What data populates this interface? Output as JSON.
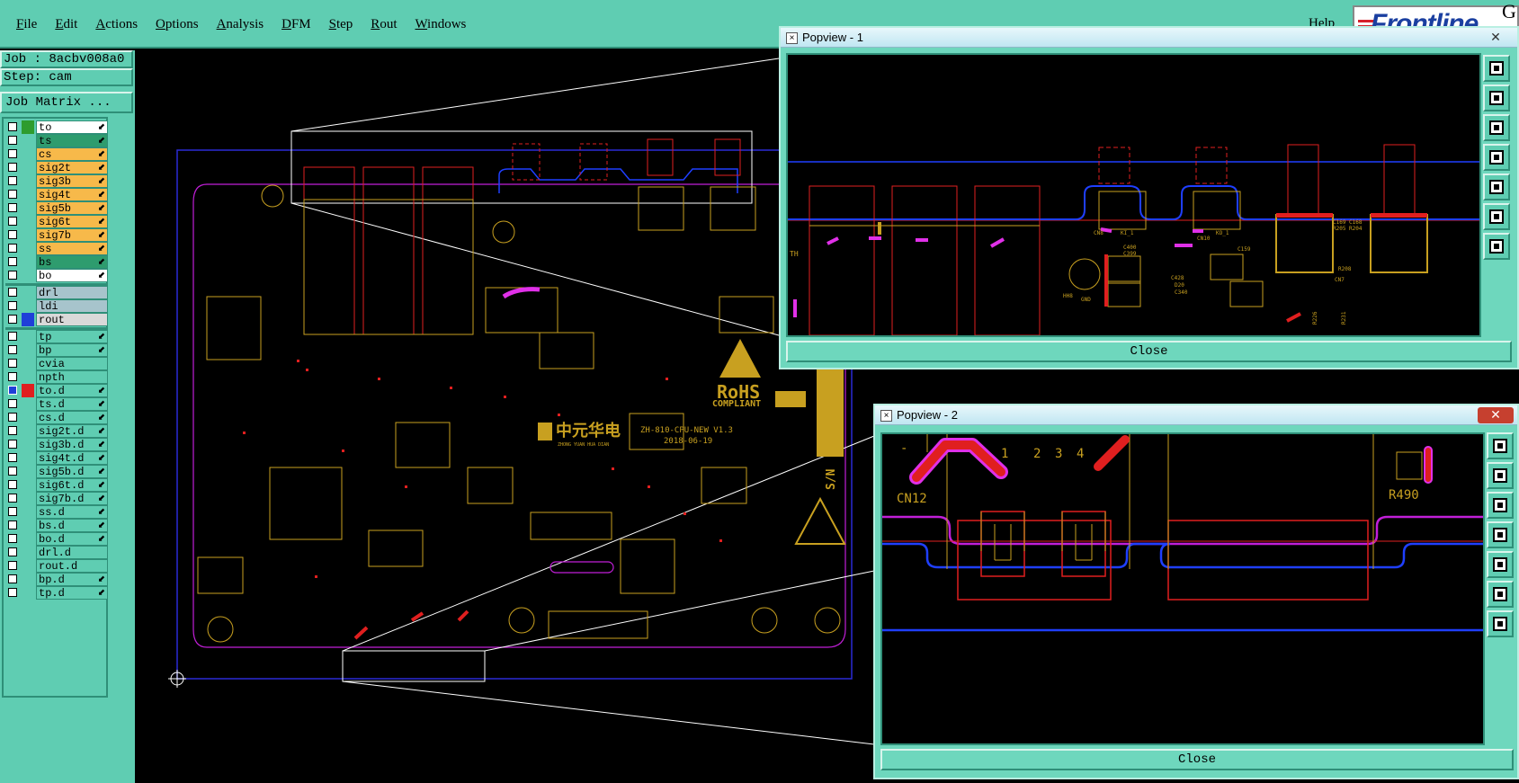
{
  "menu": {
    "items": [
      "File",
      "Edit",
      "Actions",
      "Options",
      "Analysis",
      "DFM",
      "Step",
      "Rout",
      "Windows"
    ],
    "help": "Help",
    "logo": "Frontline",
    "logo_g": "G"
  },
  "info": {
    "job": "Job : 8acbv008a0",
    "step": "Step: cam",
    "job_matrix": "Job Matrix ..."
  },
  "layers": [
    {
      "name": "to",
      "color": "#2e9c2e",
      "bg": "#ffffff",
      "arrow": true
    },
    {
      "name": "ts",
      "color": "",
      "bg": "#2e9c6e",
      "arrow": true
    },
    {
      "name": "cs",
      "color": "",
      "bg": "#f7b94a",
      "arrow": true
    },
    {
      "name": "sig2t",
      "color": "",
      "bg": "#f7b94a",
      "arrow": true
    },
    {
      "name": "sig3b",
      "color": "",
      "bg": "#f7b94a",
      "arrow": true
    },
    {
      "name": "sig4t",
      "color": "",
      "bg": "#f7b94a",
      "arrow": true
    },
    {
      "name": "sig5b",
      "color": "",
      "bg": "#f7b94a",
      "arrow": true
    },
    {
      "name": "sig6t",
      "color": "",
      "bg": "#f7b94a",
      "arrow": true
    },
    {
      "name": "sig7b",
      "color": "",
      "bg": "#f7b94a",
      "arrow": true
    },
    {
      "name": "ss",
      "color": "",
      "bg": "#f7b94a",
      "arrow": true
    },
    {
      "name": "bs",
      "color": "",
      "bg": "#2e9c6e",
      "arrow": true
    },
    {
      "name": "bo",
      "color": "",
      "bg": "#ffffff",
      "arrow": true
    },
    {
      "name": "drl",
      "color": "",
      "bg": "#a7c4cc",
      "arrow": false
    },
    {
      "name": "ldi",
      "color": "",
      "bg": "#a7c4cc",
      "arrow": false
    },
    {
      "name": "rout",
      "color": "#1f3fd8",
      "bg": "#d9d9d9",
      "arrow": false
    },
    {
      "name": "tp",
      "color": "",
      "bg": "#5fcdb2",
      "arrow": true
    },
    {
      "name": "bp",
      "color": "",
      "bg": "#5fcdb2",
      "arrow": true
    },
    {
      "name": "cvia",
      "color": "",
      "bg": "#5fcdb2",
      "arrow": false
    },
    {
      "name": "npth",
      "color": "",
      "bg": "#5fcdb2",
      "arrow": false
    },
    {
      "name": "to.d",
      "color": "#e01f1f",
      "bg": "#5fcdb2",
      "arrow": true
    },
    {
      "name": "ts.d",
      "color": "",
      "bg": "#5fcdb2",
      "arrow": true
    },
    {
      "name": "cs.d",
      "color": "",
      "bg": "#5fcdb2",
      "arrow": true
    },
    {
      "name": "sig2t.d",
      "color": "",
      "bg": "#5fcdb2",
      "arrow": true
    },
    {
      "name": "sig3b.d",
      "color": "",
      "bg": "#5fcdb2",
      "arrow": true
    },
    {
      "name": "sig4t.d",
      "color": "",
      "bg": "#5fcdb2",
      "arrow": true
    },
    {
      "name": "sig5b.d",
      "color": "",
      "bg": "#5fcdb2",
      "arrow": true
    },
    {
      "name": "sig6t.d",
      "color": "",
      "bg": "#5fcdb2",
      "arrow": true
    },
    {
      "name": "sig7b.d",
      "color": "",
      "bg": "#5fcdb2",
      "arrow": true
    },
    {
      "name": "ss.d",
      "color": "",
      "bg": "#5fcdb2",
      "arrow": true
    },
    {
      "name": "bs.d",
      "color": "",
      "bg": "#5fcdb2",
      "arrow": true
    },
    {
      "name": "bo.d",
      "color": "",
      "bg": "#5fcdb2",
      "arrow": true
    },
    {
      "name": "drl.d",
      "color": "",
      "bg": "#5fcdb2",
      "arrow": false
    },
    {
      "name": "rout.d",
      "color": "",
      "bg": "#5fcdb2",
      "arrow": false
    },
    {
      "name": "bp.d",
      "color": "",
      "bg": "#5fcdb2",
      "arrow": true
    },
    {
      "name": "tp.d",
      "color": "",
      "bg": "#5fcdb2",
      "arrow": true
    }
  ],
  "board": {
    "rohs": "RoHS",
    "compliant": "COMPLIANT",
    "brand_cn": "中元华电",
    "brand_py": "ZHONG YUAN HUA DIAN",
    "part_no": "ZH-810-CPU-NEW V1.3",
    "date": "2018-06-19",
    "sn": "S/N"
  },
  "popview1": {
    "title": "Popview - 1",
    "close": "Close",
    "labels": [
      "TH",
      "CN8",
      "KI_1",
      "CN10",
      "KO_1",
      "C400",
      "C399",
      "C428",
      "D20",
      "C340",
      "C159",
      "GND",
      "HH8",
      "CN7",
      "R226",
      "R231",
      "C169",
      "R205",
      "R204",
      "C168",
      "R208"
    ]
  },
  "popview2": {
    "title": "Popview - 2",
    "close": "Close",
    "labels": [
      "1",
      "2",
      "3",
      "4",
      "CN12",
      "R490",
      "-"
    ]
  },
  "colors": {
    "panel": "#5fcdb2",
    "board_outline": "#2b2bd6",
    "trace_yellow": "#c8a020",
    "trace_red": "#e01f1f",
    "magenta": "#e030e8",
    "blue_line": "#1f3fff"
  }
}
